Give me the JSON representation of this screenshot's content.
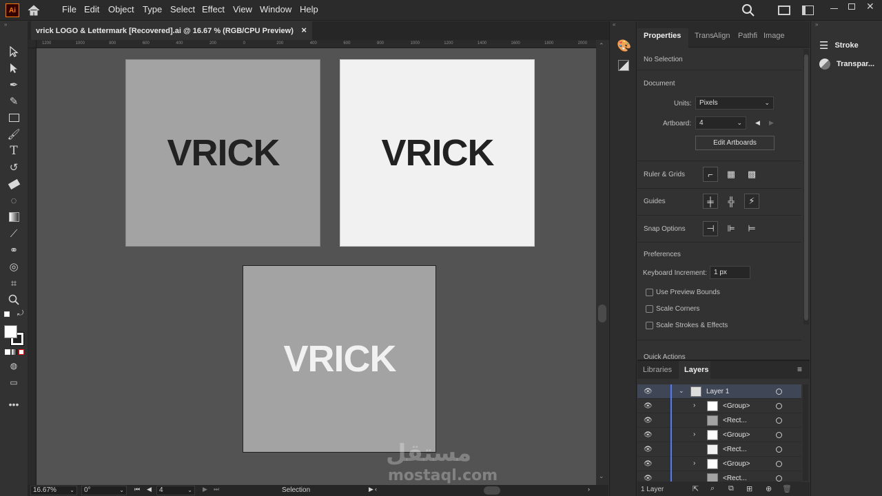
{
  "menu": [
    "File",
    "Edit",
    "Object",
    "Type",
    "Select",
    "Effect",
    "View",
    "Window",
    "Help"
  ],
  "app_logo": "Ai",
  "document_tab": "vrick LOGO & Lettermark [Recovered].ai @ 16.67 % (RGB/CPU Preview)",
  "tab_close": "×",
  "ruler_ticks": [
    "1200",
    "1000",
    "800",
    "600",
    "400",
    "200",
    "0",
    "200",
    "400",
    "600",
    "800",
    "1000",
    "1200",
    "1400",
    "1600",
    "1800",
    "2000"
  ],
  "artboard_logo_text": "VRICK",
  "colors": {
    "artboard_gray": "#a3a3a3",
    "artboard_white": "#f1f1f1",
    "logo_dark": "#222222",
    "logo_light": "#f1f1f1",
    "layer_blue": "#4f7cff"
  },
  "status": {
    "zoom": "16.67%",
    "rotation": "0°",
    "artboard_num": "4",
    "tool": "Selection"
  },
  "properties": {
    "tabs": [
      "Properties",
      "Trans",
      "Align",
      "Pathfi",
      "Image"
    ],
    "no_selection": "No Selection",
    "document": "Document",
    "units_label": "Units:",
    "units_value": "Pixels",
    "artboard_label": "Artboard:",
    "artboard_value": "4",
    "edit_artboards": "Edit Artboards",
    "ruler_grids": "Ruler & Grids",
    "guides": "Guides",
    "snap_options": "Snap Options",
    "preferences": "Preferences",
    "keyboard_increment_label": "Keyboard Increment:",
    "keyboard_increment_value": "1 px",
    "use_preview_bounds": "Use Preview Bounds",
    "scale_corners": "Scale Corners",
    "scale_strokes": "Scale Strokes & Effects",
    "quick_actions": "Quick Actions"
  },
  "layers_panel": {
    "tabs": [
      "Libraries",
      "Layers"
    ],
    "rows": [
      {
        "name": "Layer 1"
      },
      {
        "name": "<Group>"
      },
      {
        "name": "<Rect..."
      },
      {
        "name": "<Group>"
      },
      {
        "name": "<Rect..."
      },
      {
        "name": "<Group>"
      },
      {
        "name": "<Rect..."
      }
    ],
    "footer": "1 Layer"
  },
  "right_dock": [
    "Stroke",
    "Transpar..."
  ],
  "watermark": {
    "arabic": "مستقل",
    "latin": "mostaql.com"
  }
}
